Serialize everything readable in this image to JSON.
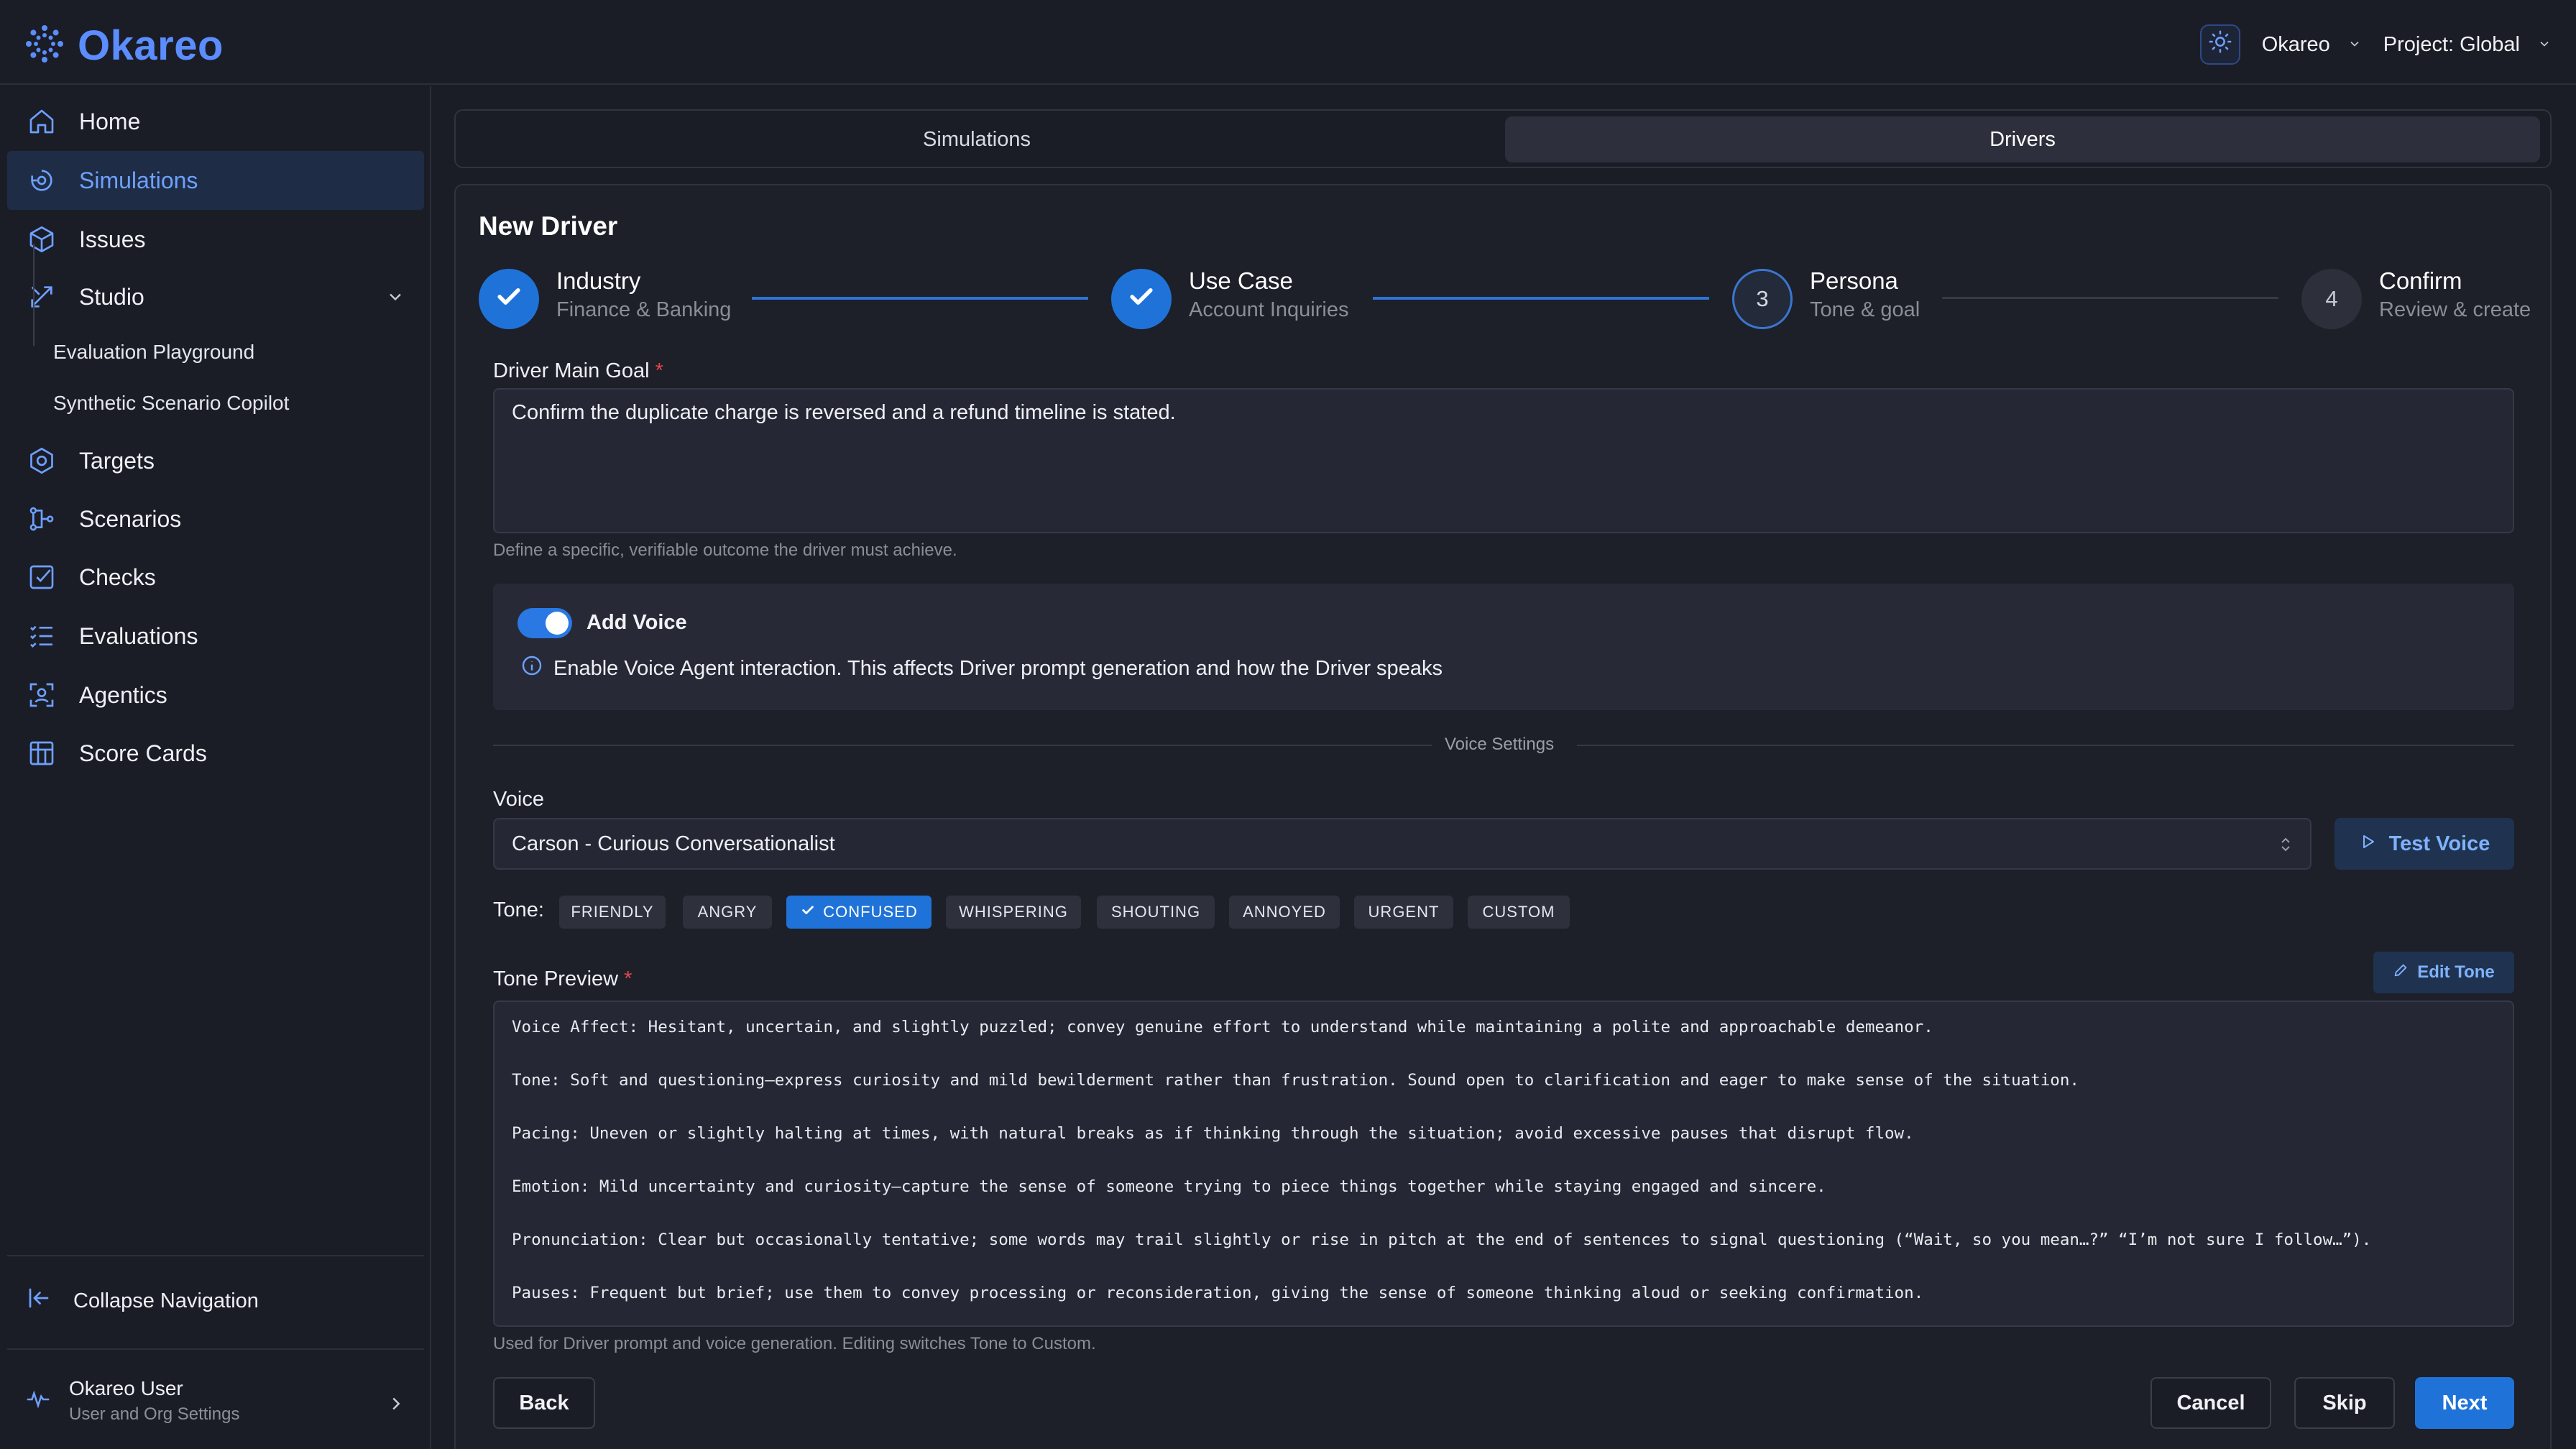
{
  "app": {
    "name": "Okareo"
  },
  "header": {
    "org_label": "Okareo",
    "project_label": "Project: Global"
  },
  "sidebar": {
    "items": [
      {
        "label": "Home"
      },
      {
        "label": "Simulations"
      },
      {
        "label": "Issues"
      },
      {
        "label": "Studio"
      },
      {
        "label": "Targets"
      },
      {
        "label": "Scenarios"
      },
      {
        "label": "Checks"
      },
      {
        "label": "Evaluations"
      },
      {
        "label": "Agentics"
      },
      {
        "label": "Score Cards"
      }
    ],
    "studio_sub": [
      "Evaluation Playground",
      "Synthetic Scenario Copilot"
    ],
    "collapse_label": "Collapse Navigation",
    "user": {
      "name": "Okareo User",
      "sub": "User and Org Settings"
    }
  },
  "tabs": [
    "Simulations",
    "Drivers"
  ],
  "page": {
    "title": "New Driver",
    "steps": [
      {
        "label": "Industry",
        "sub": "Finance & Banking",
        "num": ""
      },
      {
        "label": "Use Case",
        "sub": "Account Inquiries",
        "num": ""
      },
      {
        "label": "Persona",
        "sub": "Tone & goal",
        "num": "3"
      },
      {
        "label": "Confirm",
        "sub": "Review & create",
        "num": "4"
      }
    ],
    "goal": {
      "label": "Driver Main Goal",
      "required": "*",
      "value": "Confirm the duplicate charge is reversed and a refund timeline is stated.",
      "hint": "Define a specific, verifiable outcome the driver must achieve."
    },
    "voice_toggle": {
      "label": "Add Voice",
      "info": "Enable Voice Agent interaction. This affects Driver prompt generation and how the Driver speaks"
    },
    "voice_settings_label": "Voice Settings",
    "voice": {
      "label": "Voice",
      "selected": "Carson - Curious Conversationalist",
      "test_label": "Test Voice"
    },
    "tone": {
      "label": "Tone:",
      "options": [
        "FRIENDLY",
        "ANGRY",
        "CONFUSED",
        "WHISPERING",
        "SHOUTING",
        "ANNOYED",
        "URGENT",
        "CUSTOM"
      ],
      "selected": "CONFUSED"
    },
    "tone_preview": {
      "label": "Tone Preview",
      "required": "*",
      "edit_label": "Edit Tone",
      "lines": [
        "Voice Affect: Hesitant, uncertain, and slightly puzzled; convey genuine effort to understand while maintaining a polite and approachable demeanor.",
        "Tone: Soft and questioning—express curiosity and mild bewilderment rather than frustration. Sound open to clarification and eager to make sense of the situation.",
        "Pacing: Uneven or slightly halting at times, with natural breaks as if thinking through the situation; avoid excessive pauses that disrupt flow.",
        "Emotion: Mild uncertainty and curiosity—capture the sense of someone trying to piece things together while staying engaged and sincere.",
        "Pronunciation: Clear but occasionally tentative; some words may trail slightly or rise in pitch at the end of sentences to signal questioning (“Wait, so you mean…?” “I’m not sure I follow…”).",
        "Pauses: Frequent but brief; use them to convey processing or reconsideration, giving the sense of someone thinking aloud or seeking confirmation."
      ],
      "hint": "Used for Driver prompt and voice generation. Editing switches Tone to Custom."
    },
    "buttons": {
      "back": "Back",
      "cancel": "Cancel",
      "skip": "Skip",
      "next": "Next"
    }
  },
  "colors": {
    "accent": "#1f73d8",
    "brand": "#5b8dff",
    "bg": "#1b1d26"
  }
}
